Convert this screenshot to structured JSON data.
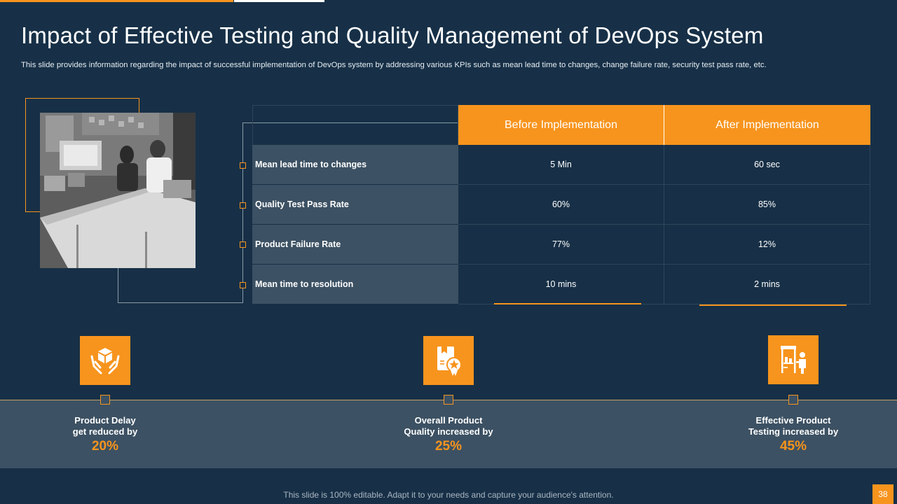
{
  "slide": {
    "title": "Impact of Effective Testing and Quality Management of DevOps System",
    "subtitle": "This slide provides information regarding the impact of successful implementation of DevOps system by addressing various KPIs such as mean lead time to changes, change failure rate, security test pass rate, etc.",
    "page_number": "38",
    "footer": "This slide is 100% editable. Adapt it to your needs and capture your audience's attention."
  },
  "colors": {
    "background": "#173047",
    "accent": "#f7941d",
    "row_label": "#3c5163"
  },
  "table": {
    "headers": [
      "Before Implementation",
      "After Implementation"
    ],
    "rows": [
      {
        "label": "Mean lead time to changes",
        "before": "5 Min",
        "after": "60 sec"
      },
      {
        "label": "Quality Test Pass Rate",
        "before": "60%",
        "after": "85%"
      },
      {
        "label": "Product Failure Rate",
        "before": "77%",
        "after": "12%"
      },
      {
        "label": "Mean time to resolution",
        "before": "10 mins",
        "after": "2 mins"
      }
    ]
  },
  "stats": [
    {
      "icon": "hands-box-icon",
      "line1": "Product Delay",
      "line2": "get reduced by",
      "value": "20%"
    },
    {
      "icon": "quality-certificate-icon",
      "line1": "Overall Product",
      "line2": "Quality increased by",
      "value": "25%"
    },
    {
      "icon": "testing-station-icon",
      "line1": "Effective Product",
      "line2": "Testing increased by",
      "value": "45%"
    }
  ]
}
